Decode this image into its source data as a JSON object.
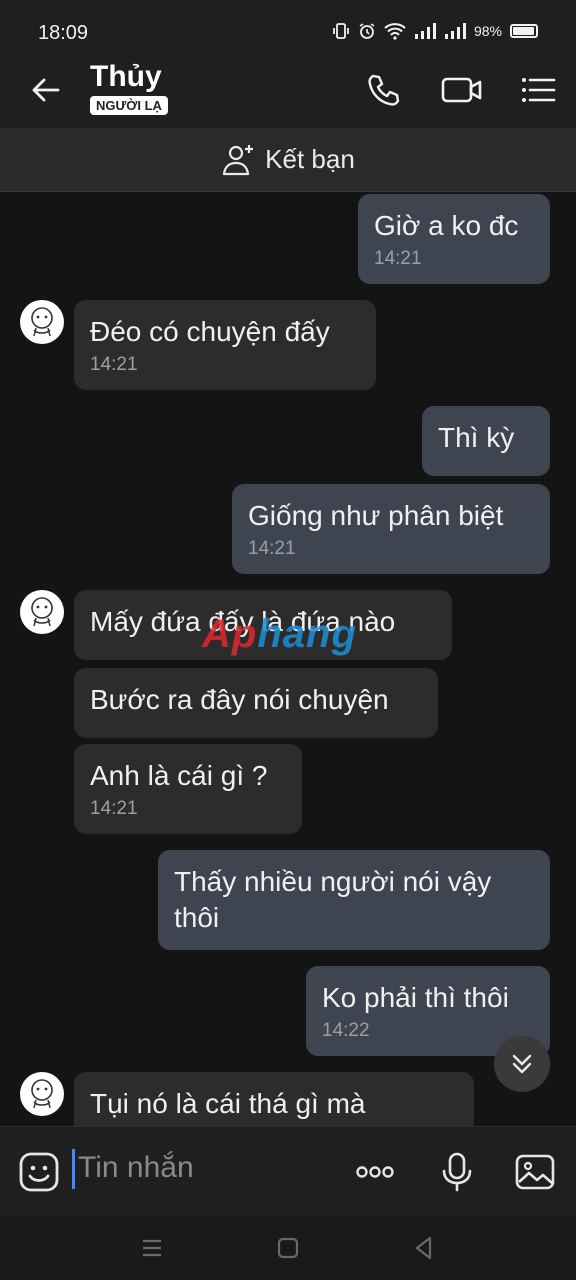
{
  "status": {
    "time": "18:09",
    "battery": "98%"
  },
  "header": {
    "name": "Thủy",
    "badge": "NGƯỜI LẠ"
  },
  "friend_bar": {
    "label": "Kết bạn"
  },
  "watermark": {
    "part1": "Ap",
    "part2": "hang"
  },
  "messages": [
    {
      "text": "Giờ a ko đc",
      "time": "14:21"
    },
    {
      "text": "Đéo có chuyện đấy",
      "time": "14:21"
    },
    {
      "text": "Thì kỳ"
    },
    {
      "text": "Giống như phân biệt",
      "time": "14:21"
    },
    {
      "text": "Mấy đứa đấy là đứa nào"
    },
    {
      "text": "Bước ra đây nói chuyện"
    },
    {
      "text": "Anh là cái gì ?",
      "time": "14:21"
    },
    {
      "text_line1": "Thấy nhiều người nói vậy",
      "text_line2": "thôi"
    },
    {
      "text": "Ko phải thì thôi",
      "time": "14:22"
    },
    {
      "text": "Tụi nó là cái thá gì mà"
    }
  ],
  "input": {
    "placeholder": "Tin nhắn"
  }
}
